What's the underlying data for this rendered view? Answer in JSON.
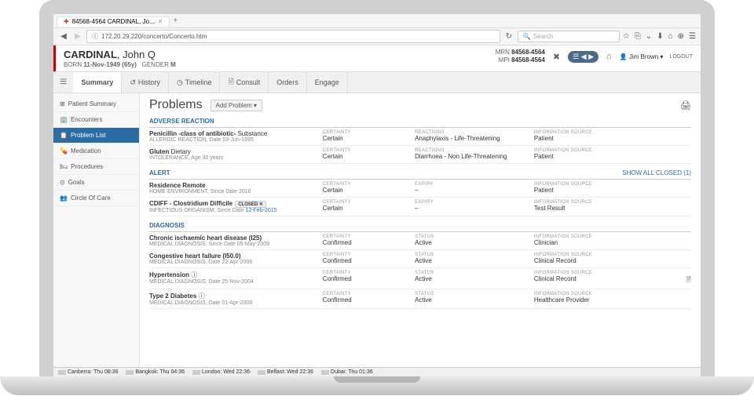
{
  "browser": {
    "tab_title": "84568-4564 CARDINAL, Jo...",
    "url": "172.20.29.220/concerto/Concerto.htm",
    "search_placeholder": "Search",
    "reload_icon": "↻"
  },
  "patient": {
    "surname": "CARDINAL",
    "given": "John Q",
    "born_label": "BORN",
    "born": "11-Nov-1949 (65y)",
    "gender_label": "GENDER",
    "gender": "M",
    "mrn_label": "MRN",
    "mrn": "84568-4564",
    "mpi_label": "MPI",
    "mpi": "84568-4564"
  },
  "user": "Jim Brown",
  "logout": "LOGOUT",
  "nav_tabs": [
    "Summary",
    "History",
    "Timeline",
    "Consult",
    "Orders",
    "Engage"
  ],
  "sidebar": [
    {
      "label": "Patient Summary",
      "icon": "⊞"
    },
    {
      "label": "Encounters",
      "icon": "🏢"
    },
    {
      "label": "Problem List",
      "icon": "📋",
      "active": true
    },
    {
      "label": "Medication",
      "icon": "💊"
    },
    {
      "label": "Procedures",
      "icon": "🛏"
    },
    {
      "label": "Goals",
      "icon": "⊙"
    },
    {
      "label": "Circle Of Care",
      "icon": "👥"
    }
  ],
  "page_title": "Problems",
  "add_label": "Add Problem ▾",
  "sections": {
    "adverse": {
      "header": "ADVERSE REACTION",
      "rows": [
        {
          "title_html": "Penicillin -class of antibiotic-",
          "title_suffix": " Substance",
          "title_red": true,
          "sub": "ALLERGIC REACTION, Date 03-Jun-1995",
          "c2l": "CERTAINTY",
          "c2v": "Certain",
          "c3l": "REACTIONS",
          "c3v": "Anaphylaxis - Life-Threatening",
          "c3_red": true,
          "c4l": "INFORMATION SOURCE",
          "c4v": "Patient"
        },
        {
          "title_html": "Gluten",
          "title_suffix": " Dietary",
          "sub": "INTOLERANCE, Age 30 years",
          "c2l": "CERTAINTY",
          "c2v": "Certain",
          "c3l": "REACTIONS",
          "c3v": "Diarrhoea - Non Life-Threatening",
          "c4l": "INFORMATION SOURCE",
          "c4v": "Patient"
        }
      ]
    },
    "alert": {
      "header": "ALERT",
      "show_all": "Show All Closed (1)",
      "rows": [
        {
          "title_html": "Residence Remote",
          "sub": "HOME ENVIRONMENT, Since Date 2010",
          "c2l": "CERTAINTY",
          "c2v": "Certain",
          "c3l": "EXPIRY",
          "c3v": "–",
          "c4l": "INFORMATION SOURCE",
          "c4v": "Patient"
        },
        {
          "title_html": "CDIFF - Clostridium Difficile",
          "badge": "CLOSED ✕",
          "sub": "INFECTIOUS ORGANISM, Since Date 12-Feb-2015",
          "sub_link": true,
          "c2l": "CERTAINTY",
          "c2v": "Certain",
          "c3l": "EXPIRY",
          "c3v": "–",
          "c4l": "INFORMATION SOURCE",
          "c4v": "Test Result"
        }
      ]
    },
    "diagnosis": {
      "header": "DIAGNOSIS",
      "rows": [
        {
          "title_html": "Chronic ischaemic heart disease (I25)",
          "sub": "MEDICAL DIAGNOSIS, Since Date 05-May-2009",
          "c2l": "CERTAINTY",
          "c2v": "Confirmed",
          "c3l": "STATUS",
          "c3v": "Active",
          "c4l": "INFORMATION SOURCE",
          "c4v": "Clinician"
        },
        {
          "title_html": "Congestive heart failure (I50.0)",
          "sub": "MEDICAL DIAGNOSIS, Date 22-Apr-2006",
          "c2l": "CERTAINTY",
          "c2v": "Confirmed",
          "c3l": "STATUS",
          "c3v": "Active",
          "c4l": "INFORMATION SOURCE",
          "c4v": "Clinical Record"
        },
        {
          "title_html": "Hypertension",
          "info": true,
          "sub": "MEDICAL DIAGNOSIS, Date 25-Nov-2004",
          "c2l": "CERTAINTY",
          "c2v": "Confirmed",
          "c3l": "STATUS",
          "c3v": "Active",
          "c4l": "INFORMATION SOURCE",
          "c4v": "Clinical Record",
          "doc_icon": true
        },
        {
          "title_html": "Type 2 Diabetes",
          "info": true,
          "sub": "MEDICAL DIAGNOSIS, Date 01-Apr-2008",
          "c2l": "CERTAINTY",
          "c2v": "Confirmed",
          "c3l": "STATUS",
          "c3v": "Active",
          "c4l": "INFORMATION SOURCE",
          "c4v": "Healthcare Provider"
        }
      ]
    }
  },
  "status_bar": [
    "Canberra: Thu 08:36",
    "Bangkok: Thu 04:36",
    "London: Wed 22:36",
    "Belfast: Wed 22:36",
    "Dubai: Thu 01:36"
  ]
}
